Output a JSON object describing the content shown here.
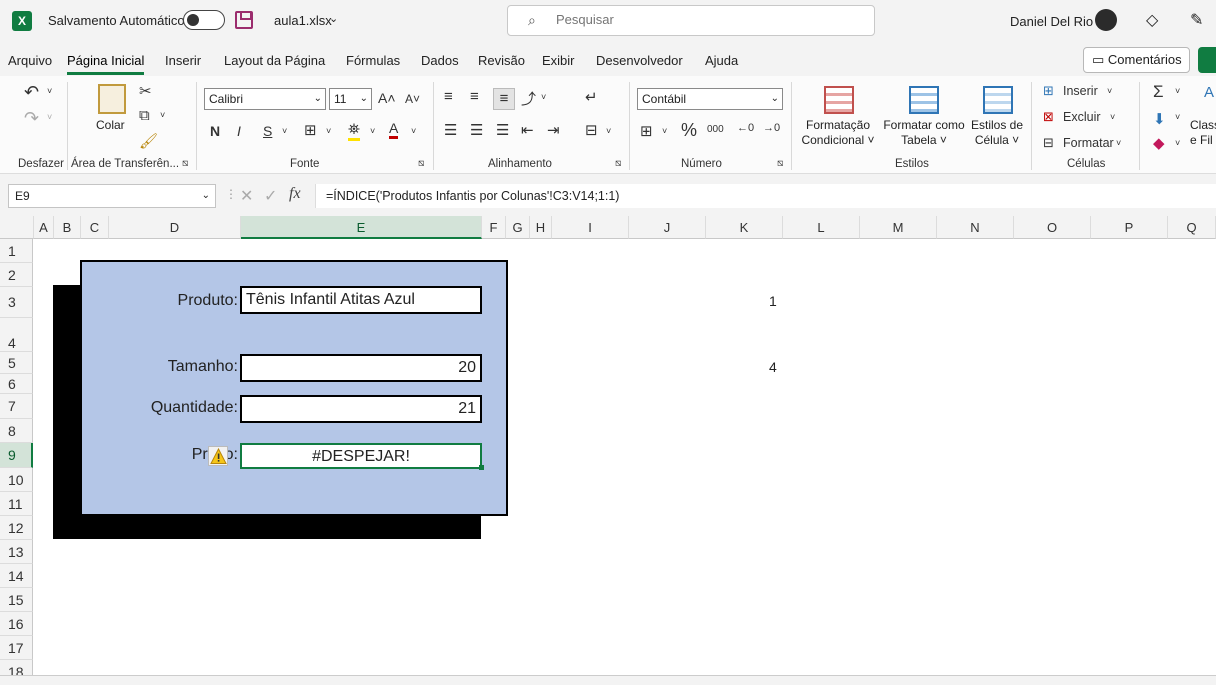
{
  "titlebar": {
    "autosave_label": "Salvamento Automático",
    "filename": "aula1.xlsx",
    "search_placeholder": "Pesquisar",
    "username": "Daniel Del Rio"
  },
  "menu": {
    "tabs": [
      "Arquivo",
      "Página Inicial",
      "Inserir",
      "Layout da Página",
      "Fórmulas",
      "Dados",
      "Revisão",
      "Exibir",
      "Desenvolvedor",
      "Ajuda"
    ],
    "active_tab": "Página Inicial",
    "comments_label": "Comentários"
  },
  "ribbon": {
    "groups": {
      "undo": "Desfazer",
      "clipboard": "Área de Transferên...",
      "font": "Fonte",
      "alignment": "Alinhamento",
      "number": "Número",
      "styles": "Estilos",
      "cells": "Células"
    },
    "paste_label": "Colar",
    "font_name": "Calibri",
    "font_size": "11",
    "number_format": "Contábil",
    "bold": "N",
    "italic": "I",
    "underline": "S",
    "percent": "%",
    "thousands": "000",
    "cond_format_line1": "Formatação",
    "cond_format_line2": "Condicional ˅",
    "format_table_line1": "Formatar como",
    "format_table_line2": "Tabela ˅",
    "cell_styles_line1": "Estilos de",
    "cell_styles_line2": "Célula ˅",
    "insert_label": "Inserir",
    "delete_label": "Excluir",
    "format_label": "Formatar",
    "sort_line1": "Class",
    "sort_line2": "e Fil"
  },
  "formula_bar": {
    "name_box": "E9",
    "formula": "=ÍNDICE('Produtos Infantis por Colunas'!C3:V14;1:1)"
  },
  "grid": {
    "columns": [
      "A",
      "B",
      "C",
      "D",
      "E",
      "F",
      "G",
      "H",
      "I",
      "J",
      "K",
      "L",
      "M",
      "N",
      "O",
      "P",
      "Q"
    ],
    "rows": [
      "1",
      "2",
      "3",
      "4",
      "5",
      "6",
      "7",
      "8",
      "9",
      "10",
      "11",
      "12",
      "13",
      "14",
      "15",
      "16",
      "17",
      "18"
    ],
    "selected_column": "E",
    "selected_row": "9"
  },
  "form": {
    "produto_label": "Produto:",
    "produto_value": "Tênis Infantil Atitas Azul",
    "tamanho_label": "Tamanho:",
    "tamanho_value": "20",
    "quantidade_label": "Quantidade:",
    "quantidade_value": "21",
    "preco_label": "Preço:",
    "preco_value": "#DESPEJAR!"
  },
  "cells": {
    "k3": "1",
    "k5": "4"
  },
  "colors": {
    "excel_green": "#107c41",
    "panel_blue": "#b4c6e7",
    "selection_header": "#d3e3d8"
  }
}
